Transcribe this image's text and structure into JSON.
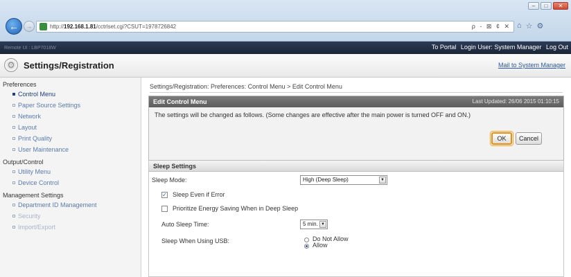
{
  "browser": {
    "url_prefix": "http://",
    "url_host": "192.168.1.81",
    "url_path": "/cctrlset.cgi?CSUT=1978726842",
    "addr_tools": "ρ - ⊠ ¢ ✕",
    "win_min": "–",
    "win_max": "□",
    "win_close": "✕",
    "back": "←",
    "forward": "→",
    "tb_icons": [
      "⌂",
      "☆",
      "⚙"
    ]
  },
  "topbar": {
    "brand": "Remote UI : LBP7018W",
    "to_portal": "To Portal",
    "login_user": "Login User: System Manager",
    "logout": "Log Out"
  },
  "titlebar": {
    "title": "Settings/Registration",
    "mail_link": "Mail to System Manager"
  },
  "sidebar": {
    "sections": [
      {
        "heading": "Preferences",
        "items": [
          {
            "label": "Control Menu",
            "active": true
          },
          {
            "label": "Paper Source Settings"
          },
          {
            "label": "Network"
          },
          {
            "label": "Layout"
          },
          {
            "label": "Print Quality"
          },
          {
            "label": "User Maintenance"
          }
        ]
      },
      {
        "heading": "Output/Control",
        "items": [
          {
            "label": "Utility Menu"
          },
          {
            "label": "Device Control"
          }
        ]
      },
      {
        "heading": "Management Settings",
        "items": [
          {
            "label": "Department ID Management"
          },
          {
            "label": "Security"
          },
          {
            "label": "Import/Export"
          }
        ]
      }
    ]
  },
  "main": {
    "breadcrumb": "Settings/Registration: Preferences: Control Menu > Edit Control Menu",
    "panel_title": "Edit Control Menu",
    "last_updated": "Last Updated: 26/06 2015 01:10:15",
    "message": "The settings will be changed as follows. (Some changes are effective after the main power is turned OFF and ON.)",
    "ok": "OK",
    "cancel": "Cancel"
  },
  "sleep": {
    "heading": "Sleep Settings",
    "mode_label": "Sleep Mode:",
    "mode_value": "High (Deep Sleep)",
    "sleep_error_label": "Sleep Even if Error",
    "sleep_error_checked": true,
    "prioritize_label": "Prioritize Energy Saving When in Deep Sleep",
    "prioritize_checked": false,
    "auto_time_label": "Auto Sleep Time:",
    "auto_time_value": "5 min.",
    "usb_label": "Sleep When Using USB:",
    "usb_options": [
      "Do Not Allow",
      "Allow"
    ],
    "usb_selected": "Allow"
  }
}
